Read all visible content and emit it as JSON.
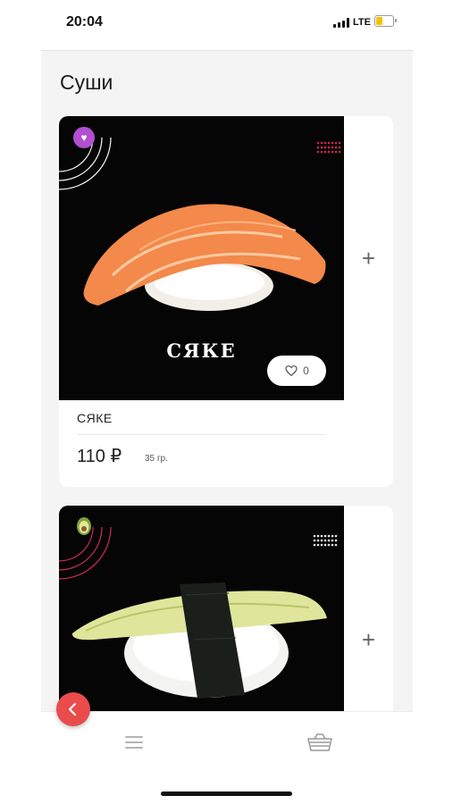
{
  "status_bar": {
    "time": "20:04",
    "network": "LTE",
    "battery_color": "#f3c300"
  },
  "page": {
    "title": "Суши"
  },
  "products": [
    {
      "brand_text": "СЯКЕ",
      "name": "СЯКЕ",
      "price": "110 ₽",
      "weight": "35 гр.",
      "likes": "0",
      "add_label": "+",
      "badge_icon": "heart-icon"
    },
    {
      "add_label": "+",
      "badge_icon": "avocado-icon"
    }
  ],
  "nav": {
    "back_icon": "chevron-left-icon",
    "menu_icon": "menu-icon",
    "basket_icon": "basket-icon"
  },
  "colors": {
    "accent_red": "#ea4b4b",
    "badge_purple": "#b14fd0",
    "screen_bg": "#f4f4f4"
  }
}
